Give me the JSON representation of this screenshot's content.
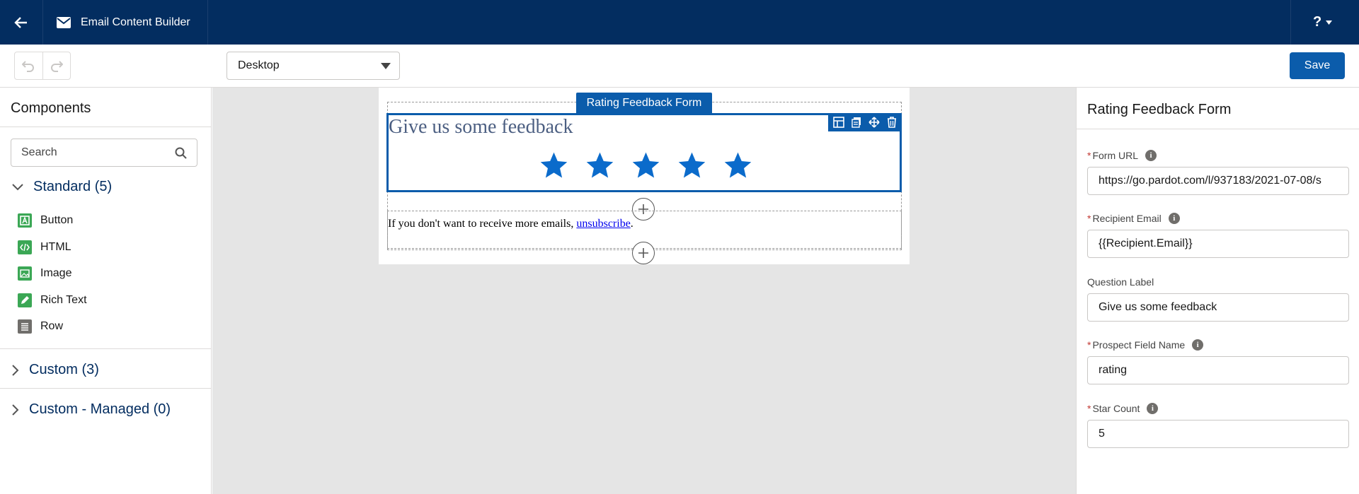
{
  "header": {
    "app_title": "Email Content Builder",
    "help_label": "?"
  },
  "toolbar": {
    "device_select": "Desktop",
    "save_label": "Save"
  },
  "components_panel": {
    "title": "Components",
    "search_placeholder": "Search",
    "sections": [
      {
        "label": "Standard (5)",
        "expanded": true
      },
      {
        "label": "Custom (3)",
        "expanded": false
      },
      {
        "label": "Custom - Managed (0)",
        "expanded": false
      }
    ],
    "standard_items": [
      {
        "label": "Button",
        "icon": "button-icon"
      },
      {
        "label": "HTML",
        "icon": "code-icon"
      },
      {
        "label": "Image",
        "icon": "image-icon"
      },
      {
        "label": "Rich Text",
        "icon": "pencil-icon"
      },
      {
        "label": "Row",
        "icon": "row-icon"
      }
    ]
  },
  "canvas": {
    "selected_block_label": "Rating Feedback Form",
    "feedback_title": "Give us some feedback",
    "star_count": 5,
    "unsubscribe_prefix": "If you don't want to receive more emails, ",
    "unsubscribe_link": "unsubscribe",
    "unsubscribe_suffix": "."
  },
  "properties_panel": {
    "title": "Rating Feedback Form",
    "fields": [
      {
        "label": "Form URL",
        "required": true,
        "info": true,
        "value": "https://go.pardot.com/l/937183/2021-07-08/s"
      },
      {
        "label": "Recipient Email",
        "required": true,
        "info": true,
        "value": "{{Recipient.Email}}"
      },
      {
        "label": "Question Label",
        "required": false,
        "info": false,
        "value": "Give us some feedback"
      },
      {
        "label": "Prospect Field Name",
        "required": true,
        "info": true,
        "value": "rating"
      },
      {
        "label": "Star Count",
        "required": true,
        "info": true,
        "value": "5"
      }
    ]
  },
  "colors": {
    "nav_bg": "#032d60",
    "brand_blue": "#0b5cab",
    "star_blue": "#0b6bcb",
    "title_gray_blue": "#4c5f82"
  }
}
